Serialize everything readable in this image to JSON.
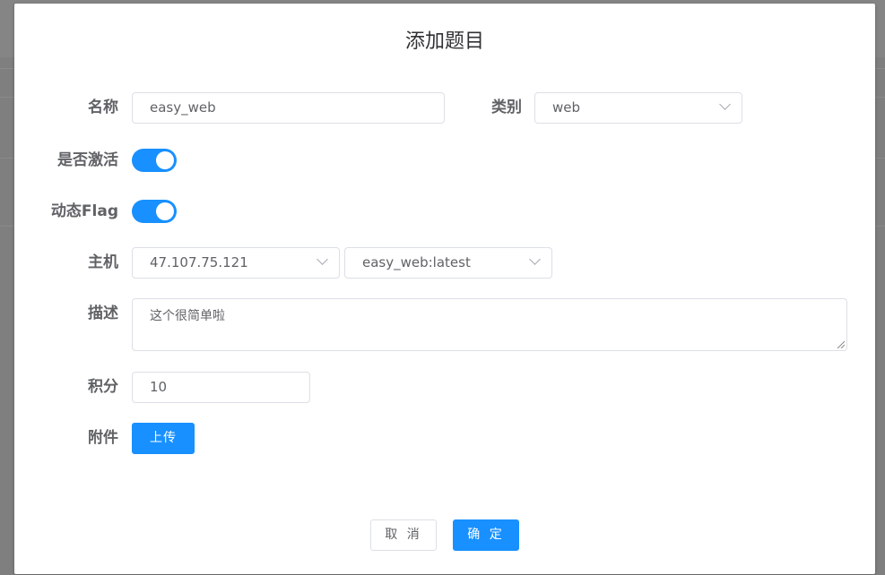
{
  "dialog": {
    "title": "添加题目"
  },
  "form": {
    "name": {
      "label": "名称",
      "value": "easy_web"
    },
    "category": {
      "label": "类别",
      "value": "web"
    },
    "active": {
      "label": "是否激活",
      "on": true
    },
    "dynamic_flag": {
      "label": "动态Flag",
      "on": true
    },
    "host": {
      "label": "主机",
      "host_value": "47.107.75.121",
      "image_value": "easy_web:latest"
    },
    "description": {
      "label": "描述",
      "value": "这个很简单啦"
    },
    "score": {
      "label": "积分",
      "value": "10"
    },
    "attachment": {
      "label": "附件",
      "upload_label": "上传"
    }
  },
  "footer": {
    "cancel_label": "取 消",
    "confirm_label": "确 定"
  },
  "colors": {
    "primary": "#1890ff",
    "overlay": "#7f7f7f"
  }
}
